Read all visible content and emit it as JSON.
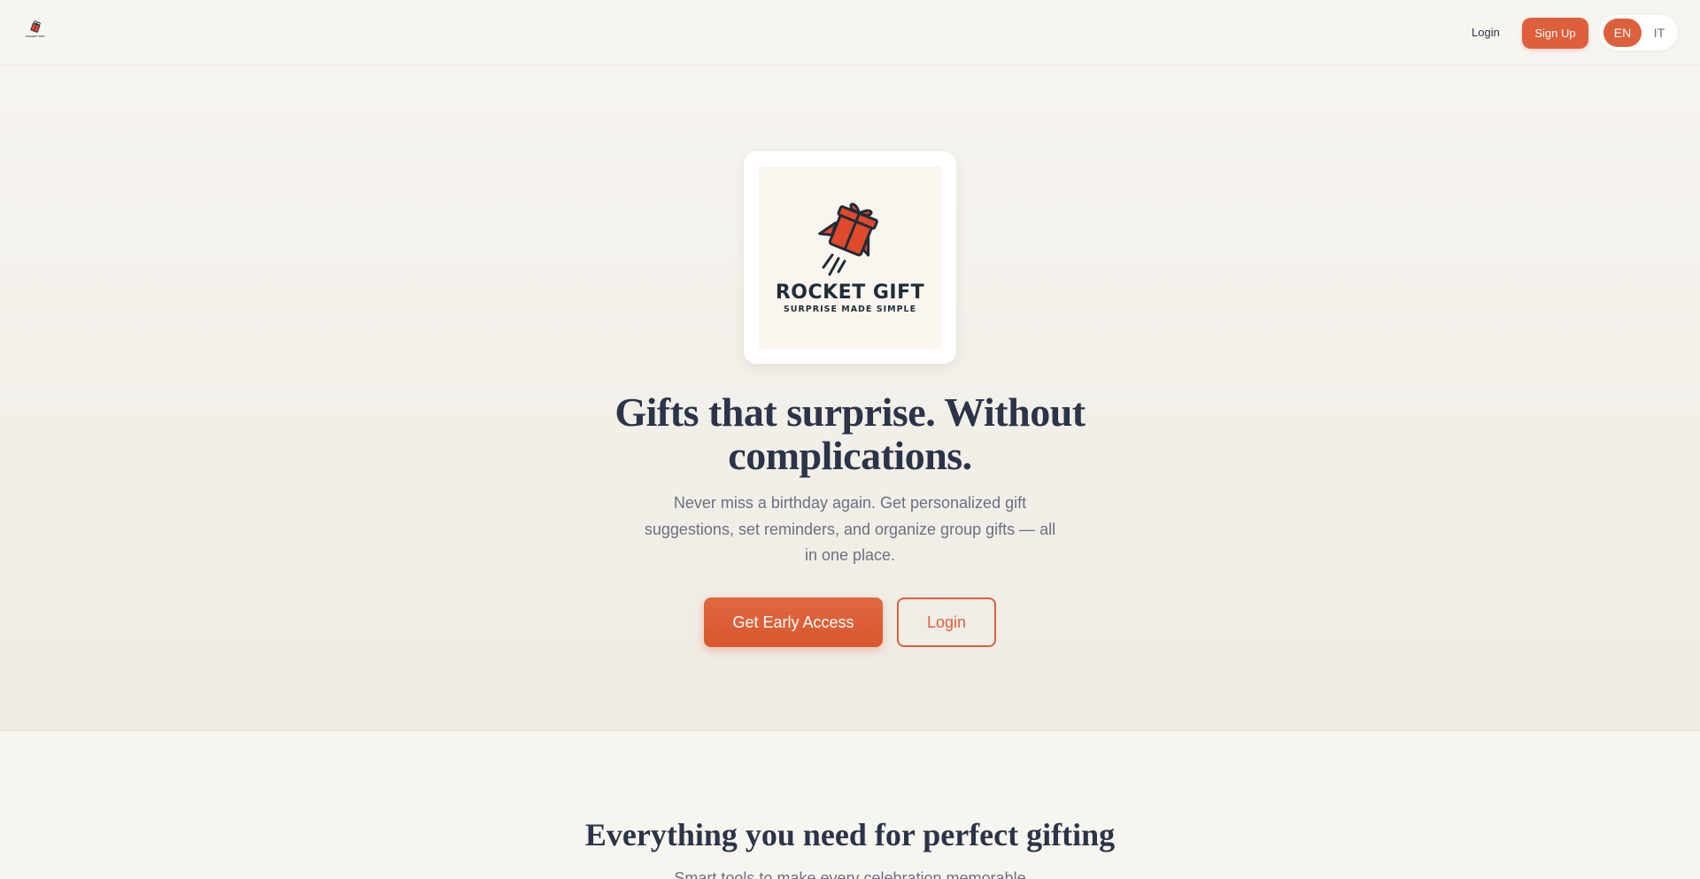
{
  "nav": {
    "logo_icon": "rocket-gift-logo-icon",
    "logo_text": "ROCKET GIFT",
    "login_label": "Login",
    "signup_label": "Sign Up",
    "languages": [
      "EN",
      "IT"
    ],
    "active_language": "EN"
  },
  "hero": {
    "brand_name": "ROCKET GIFT",
    "brand_tagline": "SURPRISE MADE SIMPLE",
    "title": "Gifts that surprise. Without complications.",
    "subtitle": "Never miss a birthday again. Get personalized gift suggestions, set reminders, and organize group gifts — all in one place.",
    "primary_cta": "Get Early Access",
    "secondary_cta": "Login"
  },
  "features": {
    "title": "Everything you need for perfect gifting",
    "subtitle": "Smart tools to make every celebration memorable"
  },
  "colors": {
    "accent": "#de5f3b",
    "background": "#f7f5f0",
    "heading": "#2b3448",
    "muted_text": "#6b7180",
    "logo_dark": "#1f2d38",
    "gift_red": "#e1492b"
  }
}
